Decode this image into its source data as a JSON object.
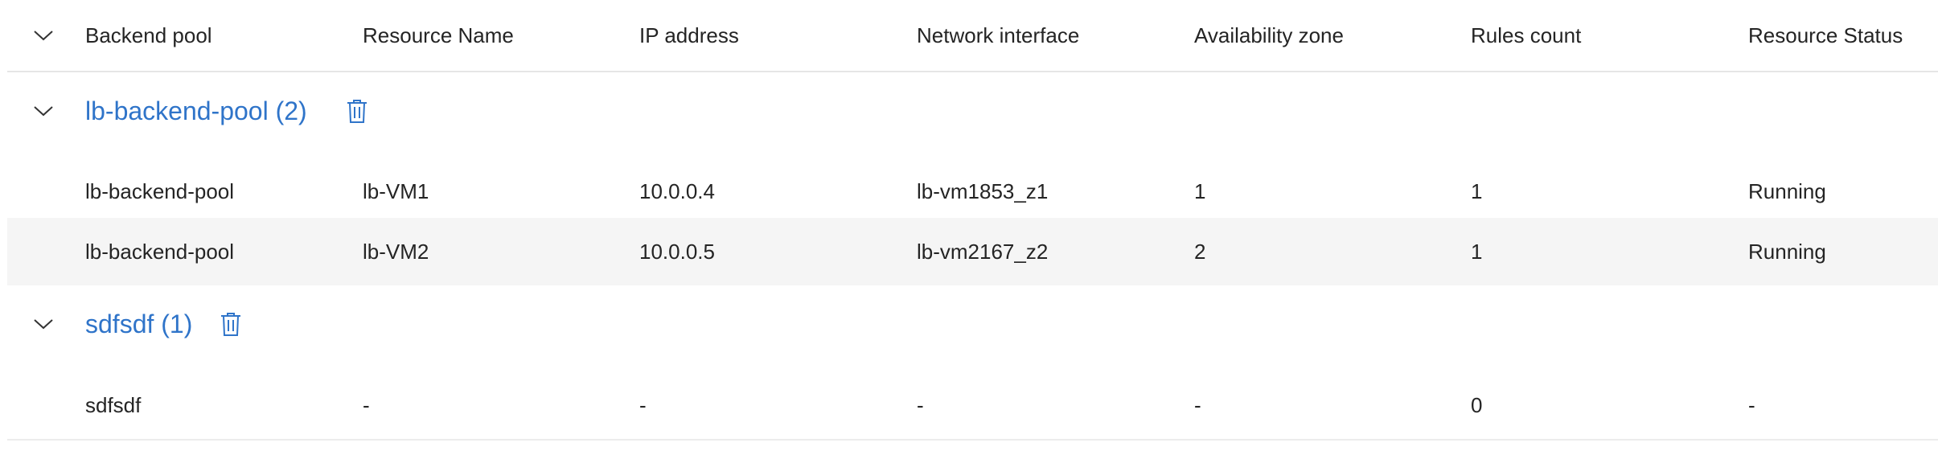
{
  "columns": [
    "Backend pool",
    "Resource Name",
    "IP address",
    "Network interface",
    "Availability zone",
    "Rules count",
    "Resource Status"
  ],
  "groups": [
    {
      "title": "lb-backend-pool (2)",
      "rows": [
        [
          "lb-backend-pool",
          "lb-VM1",
          "10.0.0.4",
          "lb-vm1853_z1",
          "1",
          "1",
          "Running"
        ],
        [
          "lb-backend-pool",
          "lb-VM2",
          "10.0.0.5",
          "lb-vm2167_z2",
          "2",
          "1",
          "Running"
        ]
      ]
    },
    {
      "title": "sdfsdf (1)",
      "rows": [
        [
          "sdfsdf",
          "-",
          "-",
          "-",
          "-",
          "0",
          "-"
        ]
      ]
    }
  ],
  "icons": {
    "expand": "chevron-down-icon",
    "delete": "trash-icon"
  },
  "colors": {
    "link": "#2f74c9",
    "row_shade": "#f5f5f5",
    "divider": "#e6e6e6"
  }
}
